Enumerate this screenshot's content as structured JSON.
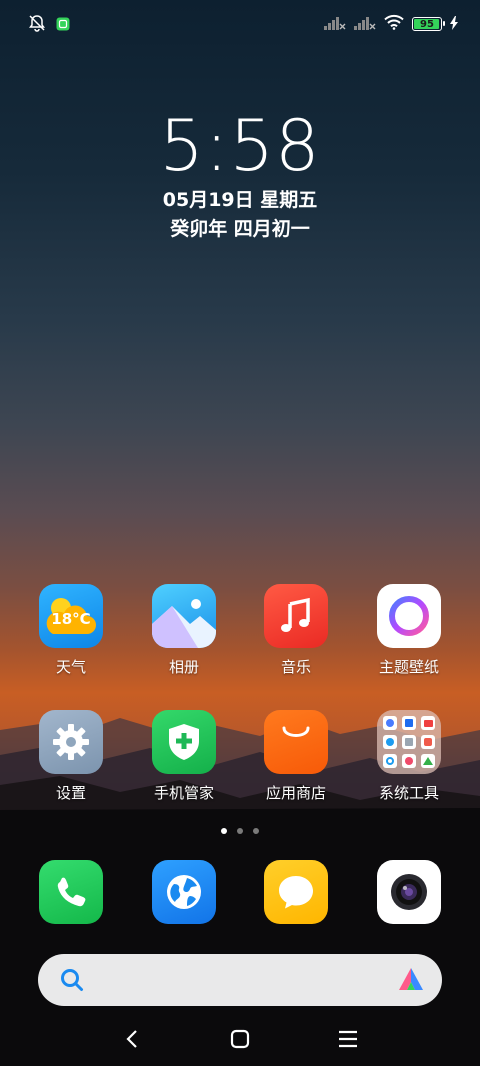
{
  "status": {
    "battery_level": "95",
    "icons": [
      "mute-bell-icon",
      "notification-app-icon",
      "signal-no-sim-icon",
      "signal-no-sim-icon",
      "wifi-icon",
      "battery-icon",
      "charging-icon"
    ]
  },
  "lockinfo": {
    "time": "5:58",
    "date": "05月19日 星期五",
    "lunar": "癸卯年 四月初一"
  },
  "apps": [
    {
      "label": "天气",
      "icon": "weather-icon",
      "temp": "18°C",
      "color": "#1e9cf0"
    },
    {
      "label": "相册",
      "icon": "gallery-icon",
      "color": "#2fb8f0"
    },
    {
      "label": "音乐",
      "icon": "music-icon",
      "color": "#f03a30"
    },
    {
      "label": "主题壁纸",
      "icon": "themes-icon",
      "color": "#ffffff"
    },
    {
      "label": "设置",
      "icon": "settings-icon",
      "color": "#8fa6bd"
    },
    {
      "label": "手机管家",
      "icon": "security-icon",
      "color": "#22c25a"
    },
    {
      "label": "应用商店",
      "icon": "app-store-icon",
      "color": "#ff6a0a"
    },
    {
      "label": "系统工具",
      "icon": "folder-icon",
      "color": "#c8a898"
    }
  ],
  "pages": {
    "count": 3,
    "active": 0
  },
  "dock": [
    {
      "name": "phone",
      "icon": "phone-icon",
      "color": "#22c45a"
    },
    {
      "name": "browser",
      "icon": "browser-icon",
      "color": "#1a8af0"
    },
    {
      "name": "messages",
      "icon": "messages-icon",
      "color": "#ffc414"
    },
    {
      "name": "camera",
      "icon": "camera-icon",
      "color": "#ffffff"
    }
  ]
}
